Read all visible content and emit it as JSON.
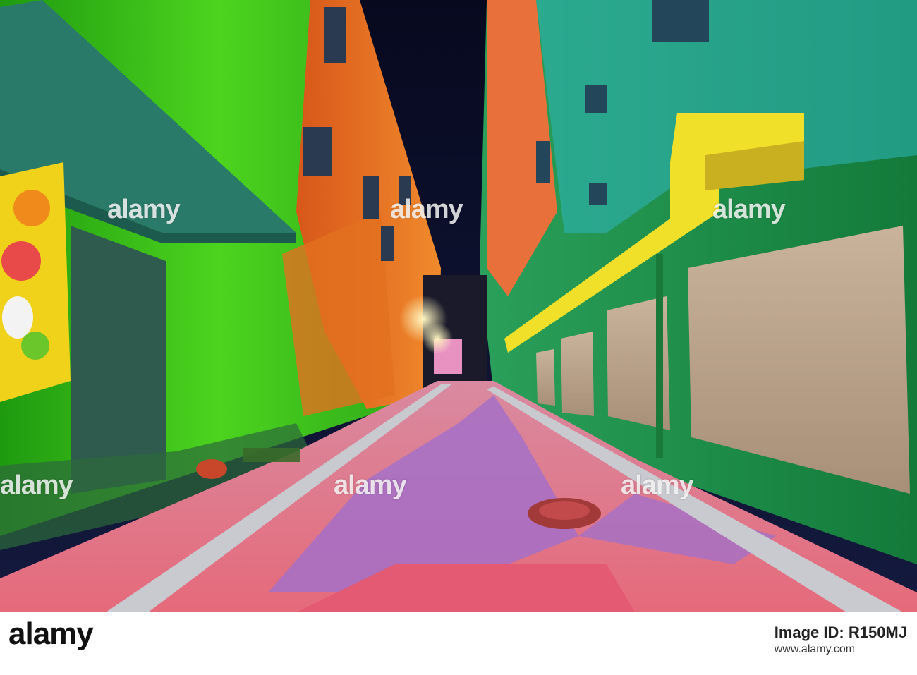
{
  "photo": {
    "subject": "colorful-alley-night"
  },
  "watermarks": {
    "text": "alamy"
  },
  "footer": {
    "brand": "alamy",
    "line1": "Image ID: R150MJ",
    "line2": "www.alamy.com"
  },
  "colors": {
    "left_wall": "#39c41a",
    "right_wall": "#1a9a4a",
    "sky": "#0b0f2a",
    "yellow_duct": "#f1e02a",
    "orange_wall": "#e96a1e",
    "road_pink": "#e8889a",
    "road_purple": "#a470c8"
  }
}
